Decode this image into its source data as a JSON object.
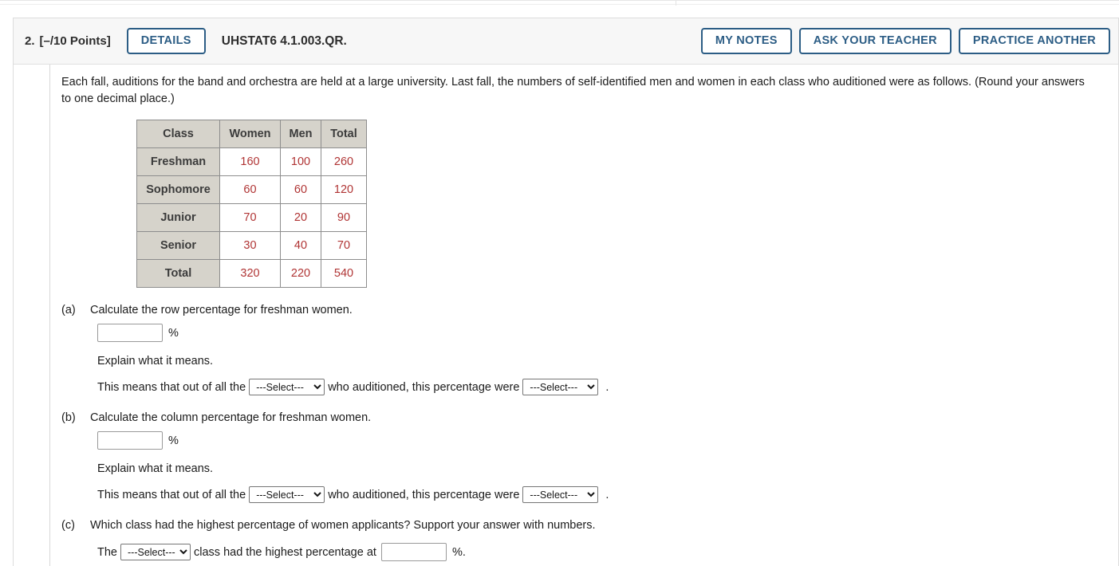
{
  "header": {
    "question_number": "2.",
    "points": "[–/10 Points]",
    "details_label": "DETAILS",
    "question_code": "UHSTAT6 4.1.003.QR.",
    "my_notes_label": "MY NOTES",
    "ask_teacher_label": "ASK YOUR TEACHER",
    "practice_another_label": "PRACTICE ANOTHER",
    "accent_color": "#2c5d85"
  },
  "intro": "Each fall, auditions for the band and orchestra are held at a large university. Last fall, the numbers of self-identified men and women in each class who auditioned were as follows. (Round your answers to one decimal place.)",
  "table": {
    "headers": [
      "Class",
      "Women",
      "Men",
      "Total"
    ],
    "rows": [
      {
        "label": "Freshman",
        "women": "160",
        "men": "100",
        "total": "260"
      },
      {
        "label": "Sophomore",
        "women": "60",
        "men": "60",
        "total": "120"
      },
      {
        "label": "Junior",
        "women": "70",
        "men": "20",
        "total": "90"
      },
      {
        "label": "Senior",
        "women": "30",
        "men": "40",
        "total": "70"
      },
      {
        "label": "Total",
        "women": "320",
        "men": "220",
        "total": "540"
      }
    ],
    "header_bg": "#d6d3cb",
    "value_color": "#b03434"
  },
  "select_placeholder": "---Select---",
  "parts": [
    {
      "label": "(a)",
      "prompt": "Calculate the row percentage for freshman women.",
      "answer_value": "",
      "percent_symbol": "%",
      "explain": "Explain what it means.",
      "means_prefix": "This means that out of all the",
      "means_middle": "who auditioned, this percentage were",
      "means_suffix": ".",
      "select1_value": "---Select---",
      "select2_value": "---Select---"
    },
    {
      "label": "(b)",
      "prompt": "Calculate the column percentage for freshman women.",
      "answer_value": "",
      "percent_symbol": "%",
      "explain": "Explain what it means.",
      "means_prefix": "This means that out of all the",
      "means_middle": "who auditioned, this percentage were",
      "means_suffix": ".",
      "select1_value": "---Select---",
      "select2_value": "---Select---"
    }
  ],
  "part_c": {
    "label": "(c)",
    "prompt": "Which class had the highest percentage of women applicants? Support your answer with numbers.",
    "sentence_prefix": "The",
    "select_value": "---Select---",
    "sentence_middle": "class had the highest percentage at",
    "answer_value": "",
    "sentence_suffix": "%."
  }
}
